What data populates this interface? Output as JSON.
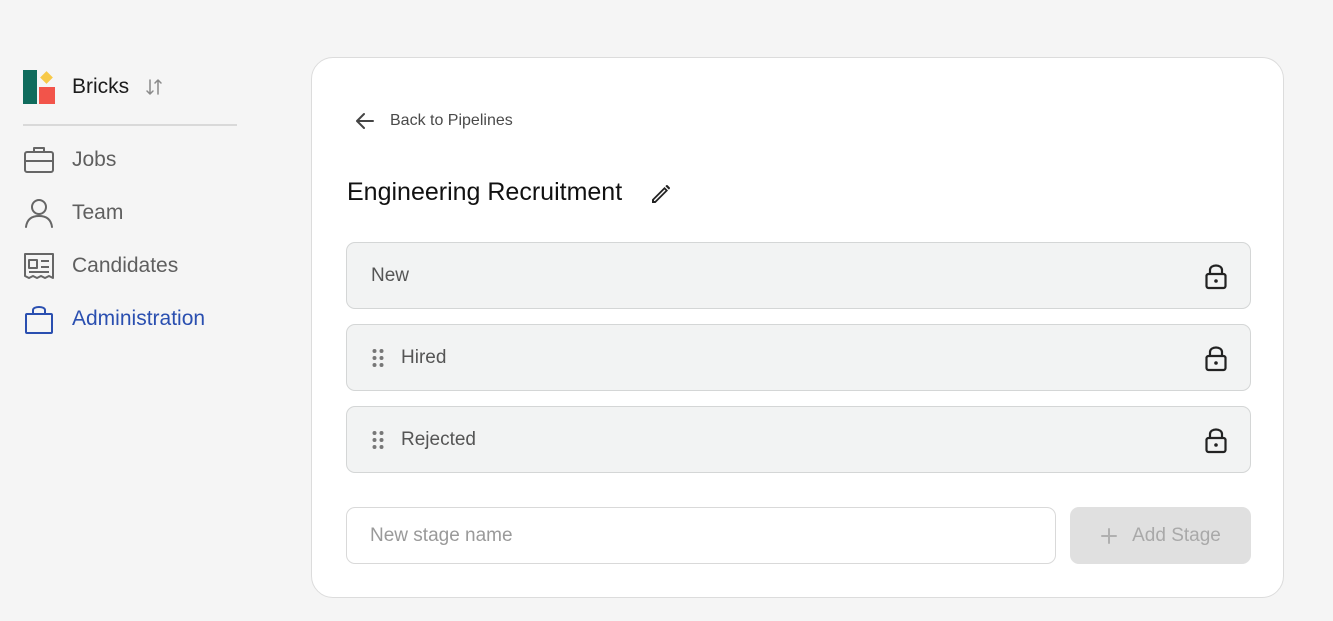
{
  "brand": {
    "name": "Bricks",
    "colors": {
      "green": "#0f6b5c",
      "red": "#f2544a",
      "yellow": "#f7c948"
    }
  },
  "sidebar": {
    "items": [
      {
        "label": "Jobs",
        "icon": "briefcase-icon",
        "active": false
      },
      {
        "label": "Team",
        "icon": "person-icon",
        "active": false
      },
      {
        "label": "Candidates",
        "icon": "id-card-icon",
        "active": false
      },
      {
        "label": "Administration",
        "icon": "shopping-bag-icon",
        "active": true
      }
    ],
    "active_color": "#2a4fb0"
  },
  "main": {
    "back_label": "Back to Pipelines",
    "title": "Engineering Recruitment",
    "stages": [
      {
        "label": "New",
        "locked": true,
        "draggable": false
      },
      {
        "label": "Hired",
        "locked": true,
        "draggable": true
      },
      {
        "label": "Rejected",
        "locked": true,
        "draggable": true
      }
    ],
    "new_stage": {
      "value": "",
      "placeholder": "New stage name"
    },
    "add_button_label": "Add Stage"
  }
}
